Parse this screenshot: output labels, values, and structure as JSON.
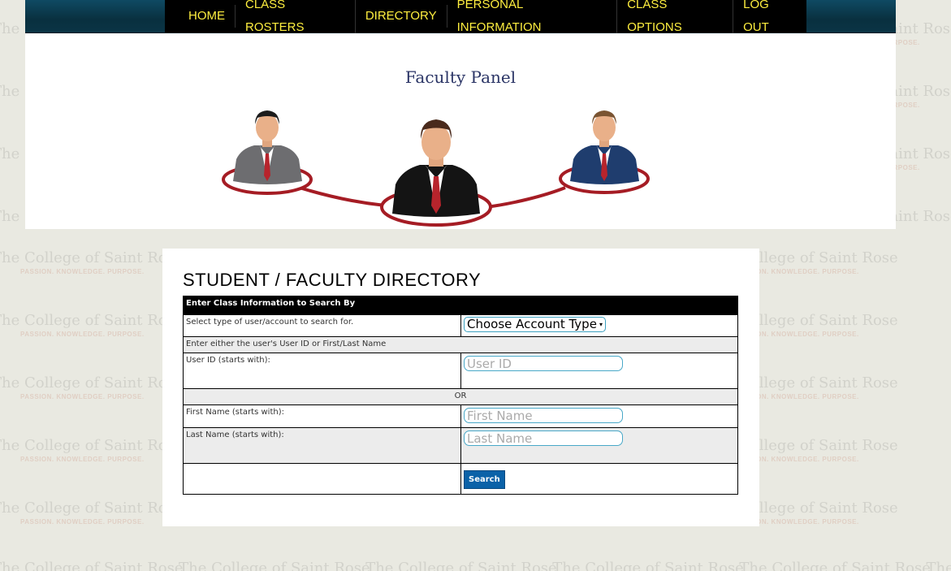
{
  "nav": {
    "items": [
      {
        "label": "HOME"
      },
      {
        "label": "CLASS ROSTERS"
      },
      {
        "label": "DIRECTORY"
      },
      {
        "label": "PERSONAL INFORMATION"
      },
      {
        "label": "CLASS OPTIONS"
      },
      {
        "label": "LOG OUT"
      }
    ]
  },
  "banner": {
    "title": "Faculty Panel"
  },
  "watermark": {
    "title": "The College of Saint Rose",
    "tagline": "PASSION. KNOWLEDGE. PURPOSE."
  },
  "directory": {
    "heading": "STUDENT / FACULTY DIRECTORY",
    "table_header": "Enter Class Information to Search By",
    "account_type_label": "Select type of user/account to search for.",
    "account_type_value": "Choose Account Type",
    "instruction": "Enter either the user's User ID or First/Last Name",
    "user_id_label": "User ID (starts with):",
    "user_id_placeholder": "User ID",
    "or_text": "OR",
    "first_name_label": "First Name (starts with):",
    "first_name_placeholder": "First Name",
    "last_name_label": "Last Name (starts with):",
    "last_name_placeholder": "Last Name",
    "search_label": "Search"
  },
  "colors": {
    "nav_text": "#ffef3f",
    "nav_bg": "#000000",
    "header_bar": "#0b3a4d",
    "button": "#0b62a8",
    "ring": "#a51c24"
  }
}
